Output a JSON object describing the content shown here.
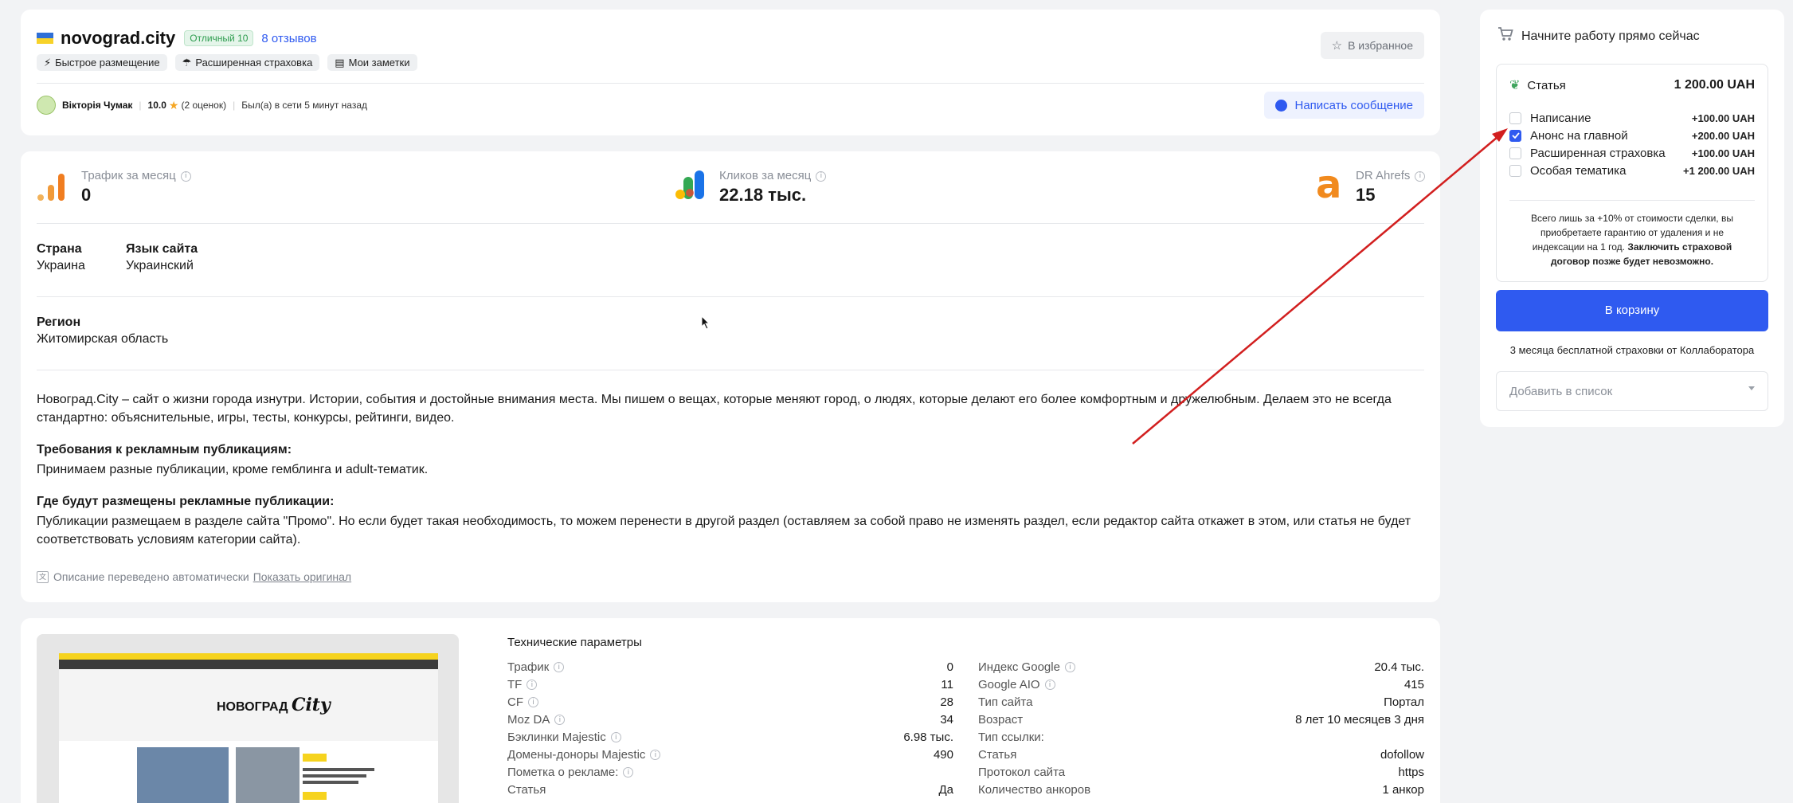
{
  "site": {
    "name": "novograd.city",
    "rating_badge": "Отличный 10",
    "reviews_link": "8 отзывов",
    "tags": [
      "Быстрое размещение",
      "Расширенная страховка",
      "Мои заметки"
    ],
    "favorite_label": "В избранное"
  },
  "owner": {
    "name": "Вікторія Чумак",
    "score": "10.0",
    "score_count": "(2 оценок)",
    "last_seen": "Был(а) в сети 5 минут назад",
    "message_label": "Написать сообщение"
  },
  "metrics": [
    {
      "label": "Трафик за месяц",
      "value": "0"
    },
    {
      "label": "Кликов за месяц",
      "value": "22.18 тыс."
    },
    {
      "label": "DR Ahrefs",
      "value": "15"
    }
  ],
  "details": {
    "country_label": "Страна",
    "country_value": "Украина",
    "lang_label": "Язык сайта",
    "lang_value": "Украинский",
    "region_label": "Регион",
    "region_value": "Житомирская область"
  },
  "description": {
    "intro": "Новоград.City – сайт о жизни города изнутри. Истории, события и достойные внимания места. Мы пишем о вещах, которые меняют город, о людях, которые делают его более комфортным и дружелюбным. Делаем это не всегда стандартно: объяснительные, игры, тесты, конкурсы, рейтинги, видео.",
    "req_title": "Требования к рекламным публикациям:",
    "req_text": "Принимаем разные публикации, кроме гемблинга и adult-тематик.",
    "where_title": "Где будут размещены рекламные публикации:",
    "where_text": "Публикации размещаем в разделе сайта \"Промо\". Но если будет такая необходимость, то можем перенести в другой раздел (оставляем за собой право не изменять раздел, если редактор сайта откажет в этом, или статья не будет соответствовать условиям категории сайта).",
    "translated_note": "Описание переведено автоматически",
    "show_original": "Показать оригинал"
  },
  "tech": {
    "title": "Технические параметры",
    "left": [
      {
        "label": "Трафик",
        "value": "0",
        "info": true
      },
      {
        "label": "TF",
        "value": "11",
        "info": true
      },
      {
        "label": "CF",
        "value": "28",
        "info": true
      },
      {
        "label": "Moz DA",
        "value": "34",
        "info": true
      },
      {
        "label": "Бэклинки Majestic",
        "value": "6.98 тыс.",
        "info": true
      },
      {
        "label": "Домены-доноры Majestic",
        "value": "490",
        "info": true
      },
      {
        "label": "Пометка о рекламе:",
        "value": "",
        "info": true
      },
      {
        "label": "Статья",
        "value": "Да",
        "info": false
      }
    ],
    "right": [
      {
        "label": "Индекс Google",
        "value": "20.4 тыс.",
        "info": true
      },
      {
        "label": "Google AIO",
        "value": "415",
        "info": true
      },
      {
        "label": "Тип сайта",
        "value": "Портал",
        "info": false
      },
      {
        "label": "Возраст",
        "value": "8 лет 10 месяцев 3 дня",
        "info": false
      },
      {
        "label": "Тип ссылки:",
        "value": "",
        "info": false
      },
      {
        "label": "Статья",
        "value": "dofollow",
        "info": false
      },
      {
        "label": "Протокол сайта",
        "value": "https",
        "info": false
      },
      {
        "label": "Количество анкоров",
        "value": "1 анкор",
        "info": false
      }
    ]
  },
  "preview": {
    "logo_text": "НОВОГРАД",
    "logo_script": "City"
  },
  "order": {
    "header": "Начните работу прямо сейчас",
    "product_label": "Статья",
    "product_price": "1 200.00 UAH",
    "options": [
      {
        "label": "Написание",
        "price": "+100.00 UAH",
        "checked": false
      },
      {
        "label": "Анонс на главной",
        "price": "+200.00 UAH",
        "checked": true
      },
      {
        "label": "Расширенная страховка",
        "price": "+100.00 UAH",
        "checked": false
      },
      {
        "label": "Особая тематика",
        "price": "+1 200.00 UAH",
        "checked": false
      }
    ],
    "insurance_text": "Всего лишь за +10% от стоимости сделки, вы приобретаете гарантию от удаления и не индексации на 1 год.",
    "insurance_bold": "Заключить страховой договор позже будет невозможно.",
    "cart_button": "В корзину",
    "free_insurance": "3 месяца бесплатной страховки от Коллаборатора",
    "add_to_list_placeholder": "Добавить в список"
  },
  "colors": {
    "accent": "#2f5af0",
    "badge_green": "#2e9d4f",
    "arrow_red": "#d21f1f",
    "ahrefs_orange": "#f18a1e"
  }
}
